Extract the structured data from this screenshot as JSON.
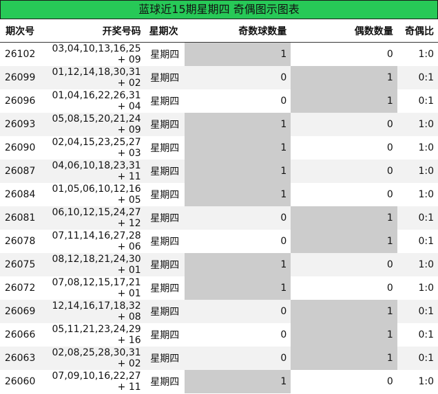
{
  "title": "蓝球近15期星期四 奇偶图示图表",
  "headers": [
    "期次号",
    "开奖号码",
    "星期次",
    "奇数球数量",
    "偶数数量",
    "奇偶比"
  ],
  "rows": [
    {
      "issue": "26102",
      "numbers": "03,04,10,13,16,25 + 09",
      "weekday": "星期四",
      "odd": "1",
      "even": "0",
      "ratio": "1:0"
    },
    {
      "issue": "26099",
      "numbers": "01,12,14,18,30,31 + 02",
      "weekday": "星期四",
      "odd": "0",
      "even": "1",
      "ratio": "0:1"
    },
    {
      "issue": "26096",
      "numbers": "01,04,16,22,26,31 + 04",
      "weekday": "星期四",
      "odd": "0",
      "even": "1",
      "ratio": "0:1"
    },
    {
      "issue": "26093",
      "numbers": "05,08,15,20,21,24 + 09",
      "weekday": "星期四",
      "odd": "1",
      "even": "0",
      "ratio": "1:0"
    },
    {
      "issue": "26090",
      "numbers": "02,04,15,23,25,27 + 03",
      "weekday": "星期四",
      "odd": "1",
      "even": "0",
      "ratio": "1:0"
    },
    {
      "issue": "26087",
      "numbers": "04,06,10,18,23,31 + 11",
      "weekday": "星期四",
      "odd": "1",
      "even": "0",
      "ratio": "1:0"
    },
    {
      "issue": "26084",
      "numbers": "01,05,06,10,12,16 + 05",
      "weekday": "星期四",
      "odd": "1",
      "even": "0",
      "ratio": "1:0"
    },
    {
      "issue": "26081",
      "numbers": "06,10,12,15,24,27 + 12",
      "weekday": "星期四",
      "odd": "0",
      "even": "1",
      "ratio": "0:1"
    },
    {
      "issue": "26078",
      "numbers": "07,11,14,16,27,28 + 06",
      "weekday": "星期四",
      "odd": "0",
      "even": "1",
      "ratio": "0:1"
    },
    {
      "issue": "26075",
      "numbers": "08,12,18,21,24,30 + 01",
      "weekday": "星期四",
      "odd": "1",
      "even": "0",
      "ratio": "1:0"
    },
    {
      "issue": "26072",
      "numbers": "07,08,12,15,17,21 + 01",
      "weekday": "星期四",
      "odd": "1",
      "even": "0",
      "ratio": "1:0"
    },
    {
      "issue": "26069",
      "numbers": "12,14,16,17,18,32 + 08",
      "weekday": "星期四",
      "odd": "0",
      "even": "1",
      "ratio": "0:1"
    },
    {
      "issue": "26066",
      "numbers": "05,11,21,23,24,29 + 16",
      "weekday": "星期四",
      "odd": "0",
      "even": "1",
      "ratio": "0:1"
    },
    {
      "issue": "26063",
      "numbers": "02,08,25,28,30,31 + 02",
      "weekday": "星期四",
      "odd": "0",
      "even": "1",
      "ratio": "0:1"
    },
    {
      "issue": "26060",
      "numbers": "07,09,10,16,22,27 + 11",
      "weekday": "星期四",
      "odd": "1",
      "even": "0",
      "ratio": "1:0"
    }
  ]
}
